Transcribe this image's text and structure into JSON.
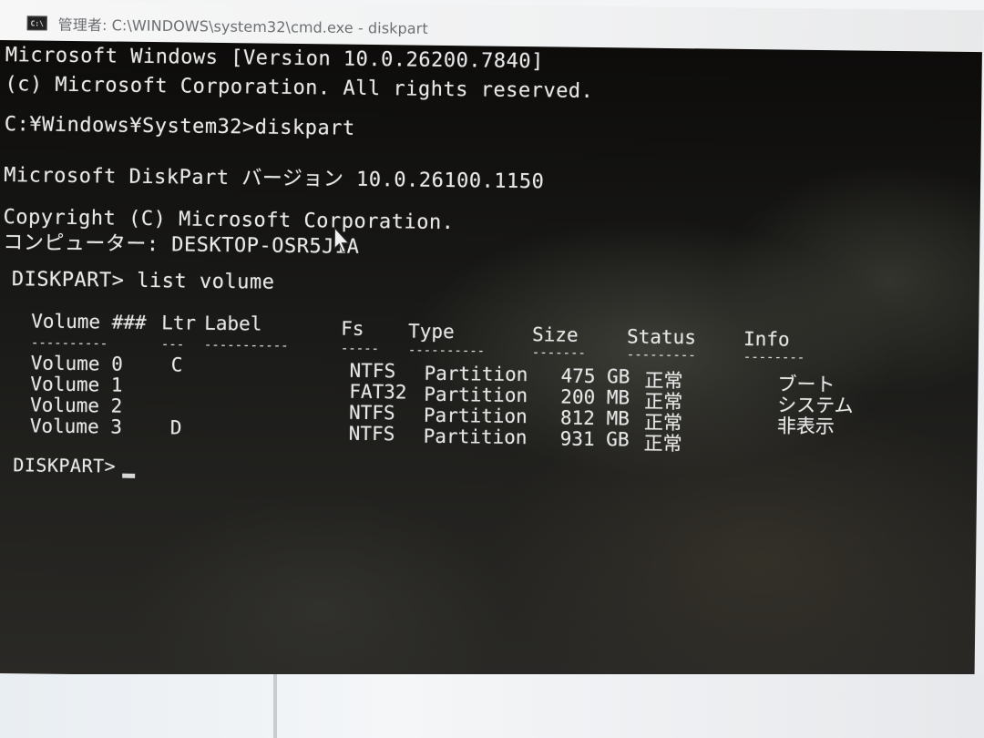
{
  "window": {
    "icon": "cmd-icon",
    "icon_text": "C:\\",
    "title": "管理者: C:\\WINDOWS\\system32\\cmd.exe - diskpart"
  },
  "console": {
    "lines": [
      "Microsoft Windows [Version 10.0.26200.7840]",
      "(c) Microsoft Corporation. All rights reserved.",
      "C:¥Windows¥System32>diskpart",
      "Microsoft DiskPart バージョン 10.0.26100.1150",
      "Copyright (C) Microsoft Corporation.",
      "コンピューター: DESKTOP-OSR5J1A",
      "DISKPART> list volume"
    ],
    "table": {
      "headers": {
        "volume": "Volume ###",
        "ltr": "Ltr",
        "label": "Label",
        "fs": "Fs",
        "type": "Type",
        "size": "Size",
        "status": "Status",
        "info": "Info"
      },
      "dashes": {
        "volume": "----------",
        "ltr": "---",
        "label": "-----------",
        "fs": "-----",
        "type": "----------",
        "size": "-------",
        "status": "---------",
        "info": "--------"
      },
      "rows": [
        {
          "volume": "Volume 0",
          "ltr": "C",
          "label": "",
          "fs": "NTFS",
          "type": "Partition",
          "size": "475 GB",
          "status": "正常",
          "info": "ブート"
        },
        {
          "volume": "Volume 1",
          "ltr": "",
          "label": "",
          "fs": "FAT32",
          "type": "Partition",
          "size": "200 MB",
          "status": "正常",
          "info": "システム"
        },
        {
          "volume": "Volume 2",
          "ltr": "",
          "label": "",
          "fs": "NTFS",
          "type": "Partition",
          "size": "812 MB",
          "status": "正常",
          "info": "非表示"
        },
        {
          "volume": "Volume 3",
          "ltr": "D",
          "label": "",
          "fs": "NTFS",
          "type": "Partition",
          "size": "931 GB",
          "status": "正常",
          "info": ""
        }
      ]
    },
    "prompt": "DISKPART>"
  }
}
